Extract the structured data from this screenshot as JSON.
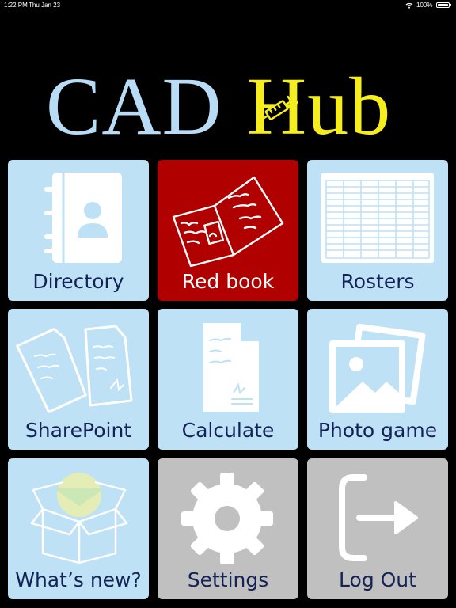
{
  "status_bar": {
    "time": "1:22 PM",
    "date": "Thu Jan 23",
    "battery": "100%"
  },
  "logo": {
    "left_text": "CAD",
    "right_text": "Hub"
  },
  "colors": {
    "tile_blue": "#bee1f6",
    "tile_red": "#b00000",
    "tile_gray": "#c0c0c0",
    "label_navy": "#132358",
    "logo_blue": "#b8dcf5",
    "logo_yellow": "#f6ee1c"
  },
  "tiles": [
    {
      "label": "Directory",
      "icon": "contact-book-icon"
    },
    {
      "label": "Red book",
      "icon": "open-book-icon"
    },
    {
      "label": "Rosters",
      "icon": "spreadsheet-icon"
    },
    {
      "label": "SharePoint",
      "icon": "documents-icon"
    },
    {
      "label": "Calculate",
      "icon": "document-icon"
    },
    {
      "label": "Photo game",
      "icon": "photos-icon"
    },
    {
      "label": "What’s new?",
      "icon": "open-box-icon"
    },
    {
      "label": "Settings",
      "icon": "gear-icon"
    },
    {
      "label": "Log Out",
      "icon": "logout-icon"
    }
  ]
}
